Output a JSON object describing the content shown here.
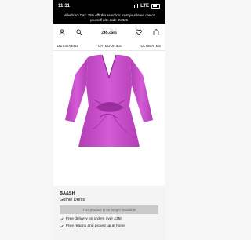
{
  "status_bar": {
    "time": "11:31",
    "network": "LTE"
  },
  "promo": {
    "line1": "Valentine's Day: 25% off* this selection: treat your loved one or",
    "line2": "yourself with code SVD25"
  },
  "header": {
    "logo_text": "24S.com",
    "logo_bg": "XN"
  },
  "nav": {
    "items": [
      "DESIGNERS",
      "CATEGORIES",
      "ULTIMATES"
    ]
  },
  "product": {
    "brand": "BA&SH",
    "name": "Gothie Dress",
    "availability": "This product is no longer available",
    "dress_color": "#c94fc9"
  },
  "features": [
    {
      "icon": "check-icon",
      "label": "Free delivery on orders over £350"
    },
    {
      "icon": "check-icon",
      "label": "Free returns and picked up at home"
    }
  ]
}
